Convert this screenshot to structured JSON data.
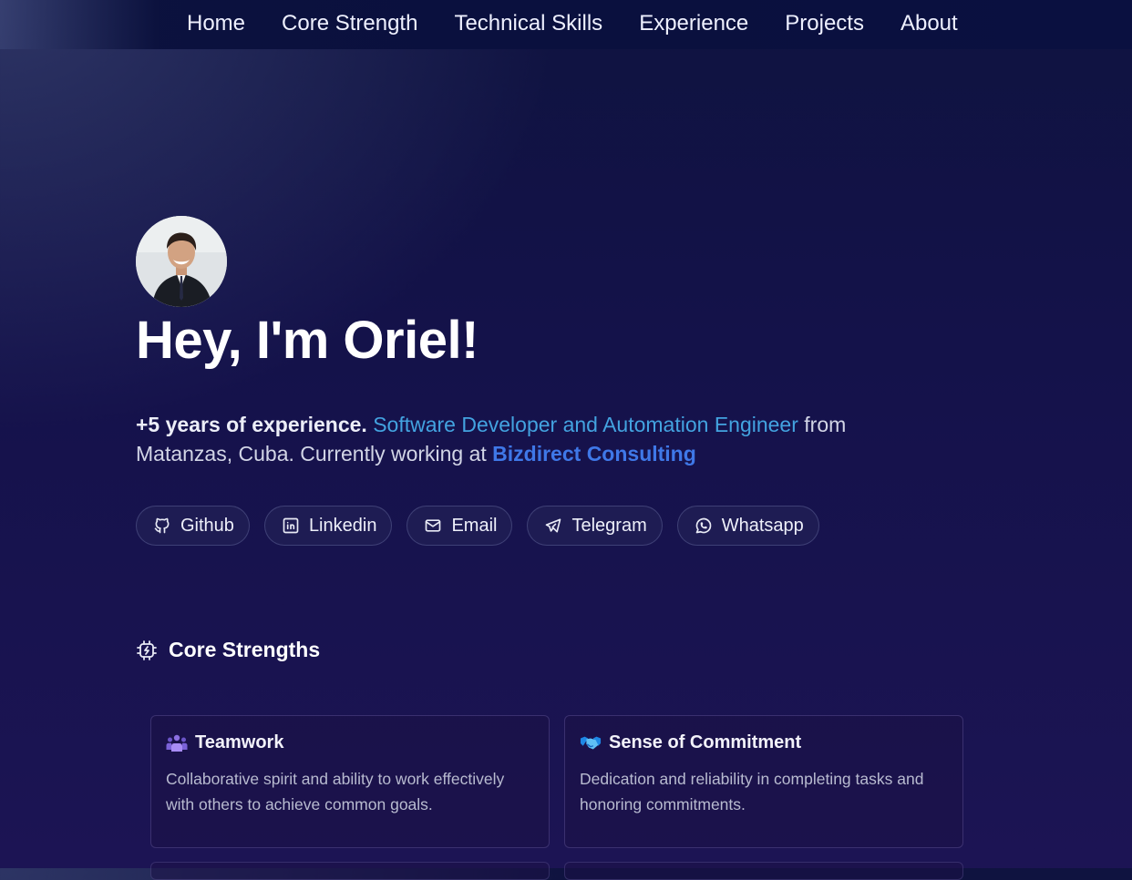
{
  "nav": {
    "items": [
      {
        "label": "Home"
      },
      {
        "label": "Core Strength"
      },
      {
        "label": "Technical Skills"
      },
      {
        "label": "Experience"
      },
      {
        "label": "Projects"
      },
      {
        "label": "About"
      }
    ]
  },
  "hero": {
    "title": "Hey, I'm Oriel!",
    "intro_strong": "+5 years of experience.",
    "intro_role": "Software Developer and Automation Engineer",
    "intro_mid": " from Matanzas, Cuba. Currently working at ",
    "intro_company": "Bizdirect Consulting"
  },
  "socials": [
    {
      "label": "Github",
      "icon": "github-icon"
    },
    {
      "label": "Linkedin",
      "icon": "linkedin-icon"
    },
    {
      "label": "Email",
      "icon": "mail-icon"
    },
    {
      "label": "Telegram",
      "icon": "send-icon"
    },
    {
      "label": "Whatsapp",
      "icon": "whatsapp-icon"
    }
  ],
  "section": {
    "title": "Core Strengths",
    "icon": "cpu-bolt-icon"
  },
  "cards": [
    {
      "title": "Teamwork",
      "icon": "team-icon",
      "description": "Collaborative spirit and ability to work effectively with others to achieve common goals."
    },
    {
      "title": "Sense of Commitment",
      "icon": "handshake-icon",
      "description": "Dedication and reliability in completing tasks and honoring commitments."
    }
  ],
  "colors": {
    "background": "#14124a",
    "role_text": "#43a3e0",
    "company_text": "#3f78e8"
  }
}
